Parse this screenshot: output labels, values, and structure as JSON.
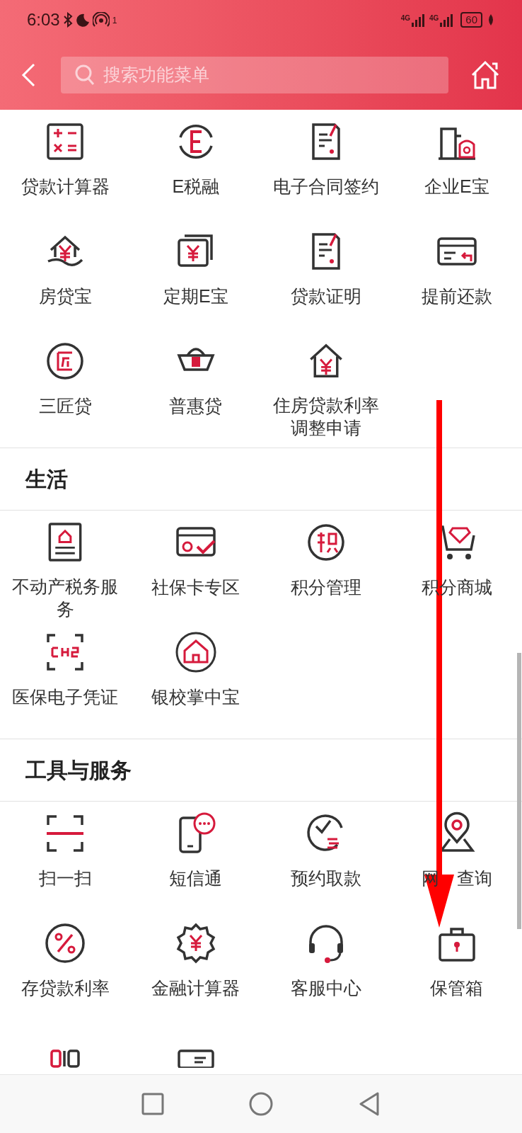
{
  "status_bar": {
    "time": "6:03",
    "hotspot_badge": "1",
    "networks": [
      "4G",
      "4G"
    ],
    "battery": "60"
  },
  "header": {
    "search": {
      "placeholder": "搜索功能菜单"
    }
  },
  "sections": [
    {
      "items": [
        {
          "kind": "full",
          "label": "贷款计算器"
        },
        {
          "kind": "full",
          "label": "E税融"
        },
        {
          "kind": "full",
          "label": "电子合同签约"
        },
        {
          "kind": "full",
          "label": "企业E宝"
        },
        {
          "kind": "full",
          "label": "房贷宝"
        },
        {
          "kind": "full",
          "label": "定期E宝"
        },
        {
          "kind": "full",
          "label": "贷款证明"
        },
        {
          "kind": "full",
          "label": "提前还款"
        },
        {
          "kind": "full",
          "label": "三匠贷"
        },
        {
          "kind": "full",
          "label": "普惠贷"
        },
        {
          "kind": "full",
          "label": "住房贷款利率调整申请"
        }
      ]
    },
    {
      "title": "生活",
      "items": [
        {
          "kind": "full",
          "label": "不动产税务服务"
        },
        {
          "kind": "full",
          "label": "社保卡专区"
        },
        {
          "kind": "full",
          "label": "积分管理"
        },
        {
          "kind": "full",
          "label": "积分商城"
        },
        {
          "kind": "full",
          "label": "医保电子凭证"
        },
        {
          "kind": "full",
          "label": "银校掌中宝"
        }
      ]
    },
    {
      "title": "工具与服务",
      "items": [
        {
          "kind": "full",
          "label": "扫一扫"
        },
        {
          "kind": "full",
          "label": "短信通"
        },
        {
          "kind": "full",
          "label": "预约取款"
        },
        {
          "kind": "full",
          "label": "网　查询"
        },
        {
          "kind": "full",
          "label": "存贷款利率"
        },
        {
          "kind": "full",
          "label": "金融计算器"
        },
        {
          "kind": "full",
          "label": "客服中心"
        },
        {
          "kind": "full",
          "label": "保管箱"
        },
        {
          "kind": "cut"
        },
        {
          "kind": "cut"
        }
      ]
    }
  ]
}
